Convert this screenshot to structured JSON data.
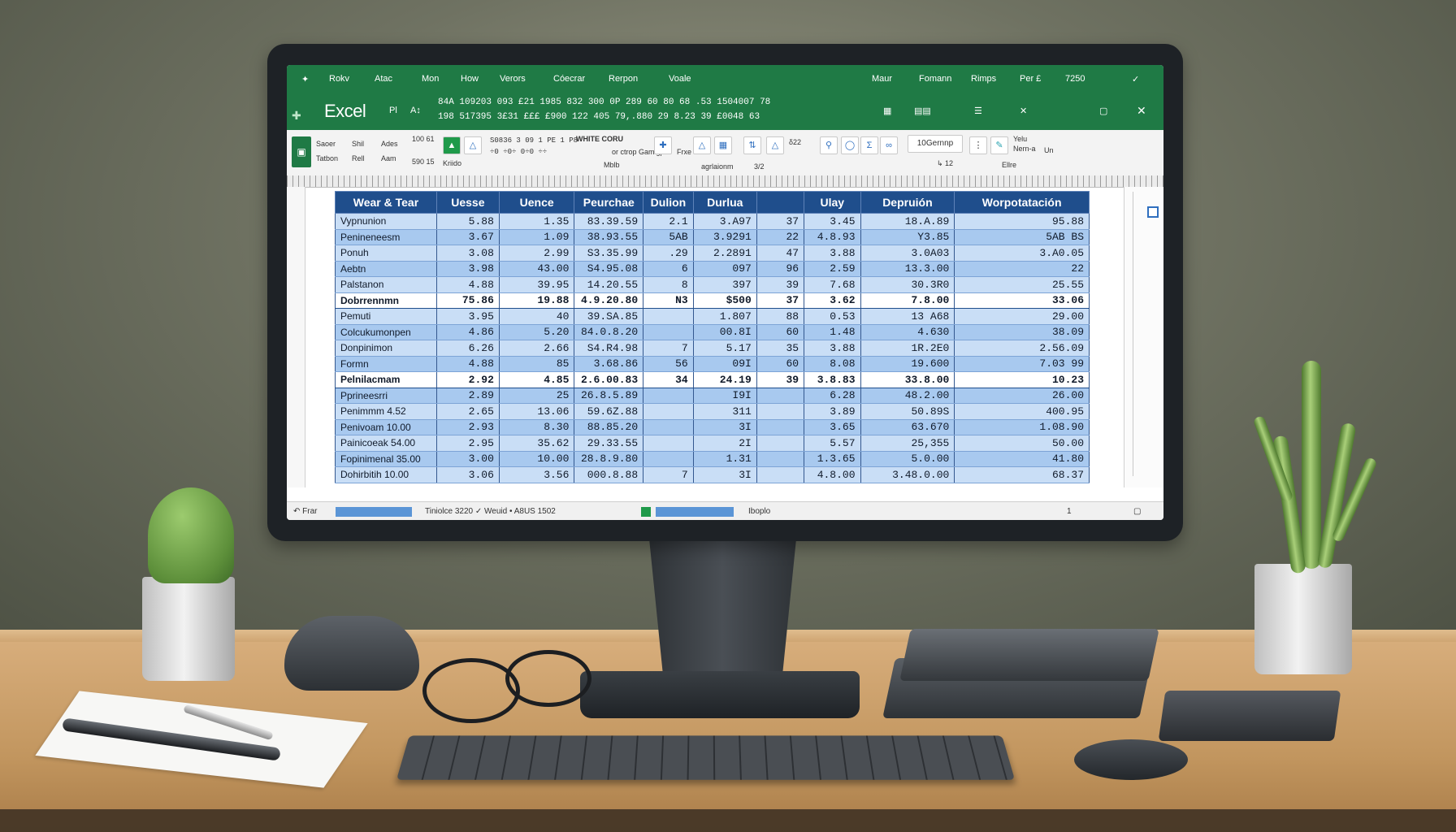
{
  "ribbon": {
    "tabs": [
      "Rokv",
      "Atac",
      "Mon",
      "How",
      "Verors",
      "Cóecrar",
      "Rerpon",
      "Voale"
    ],
    "right_tabs": [
      "Maur",
      "Fomann",
      "Rimps",
      "Per £"
    ],
    "right_value": "7250",
    "app_name": "Excel",
    "num_row_1": "84A  109203  093  £21  1985  832  300  0P  289  60  80  68  .53  1504007  78",
    "num_row_2": "198  517395  3£31  £££  £900  122  405  79,.880  29  8.23  39  £0048  63",
    "font_size": "10Gernnp",
    "tool_labels": [
      "Saoer",
      "Shil",
      "Ades",
      "Tatbon",
      "Rell",
      "Aam",
      "100 61",
      "590 15",
      "Kriido",
      "Mblb",
      "Frxe",
      "agrlaionm",
      "3/2",
      "Ellre",
      "Yelu",
      "Nern-a",
      "Un"
    ]
  },
  "sheet": {
    "headers": [
      "Wear & Tear",
      "Uesse",
      "Uence",
      "Peurchae",
      "Dulion",
      "Durlua",
      "",
      "Ulay",
      "Depruión",
      "Worpotatación"
    ],
    "rows": [
      [
        "Vypnunion",
        "5.88",
        "1.35",
        "83.39.59",
        "2.1",
        "3.A97",
        "37",
        "3.45",
        "18.A.89",
        "95.88"
      ],
      [
        "Penineneesm",
        "3.67",
        "1.09",
        "38.93.55",
        "5AB",
        "3.9291",
        "22",
        "4.8.93",
        "Y3.85",
        "5AB BS"
      ],
      [
        "Ponuh",
        "3.08",
        "2.99",
        "S3.35.99",
        ".29",
        "2.2891",
        "47",
        "3.88",
        "3.0A03",
        "3.A0.05"
      ],
      [
        "Aebtn",
        "3.98",
        "43.00",
        "S4.95.08",
        "6",
        "097",
        "96",
        "2.59",
        "13.3.00",
        "22"
      ],
      [
        "Palstanon",
        "4.88",
        "39.95",
        "14.20.55",
        "8",
        "397",
        "39",
        "7.68",
        "30.3R0",
        "25.55"
      ],
      [
        "Dobrrennmn",
        "75.86",
        "19.88",
        "4.9.20.80",
        "N3",
        "$500",
        "37",
        "3.62",
        "7.8.00",
        "33.06"
      ],
      [
        "Pemuti",
        "3.95",
        "40",
        "39.SA.85",
        "",
        "1.807",
        "88",
        "0.53",
        "13 A68",
        "29.00"
      ],
      [
        "Colcukumonpen",
        "4.86",
        "5.20",
        "84.0.8.20",
        "",
        "00.8I",
        "60",
        "1.48",
        "4.630",
        "38.09"
      ],
      [
        "Donpinimon",
        "6.26",
        "2.66",
        "S4.R4.98",
        "7",
        "5.17",
        "35",
        "3.88",
        "1R.2E0",
        "2.56.09"
      ],
      [
        "Formn",
        "4.88",
        "85",
        "3.68.86",
        "56",
        "09I",
        "60",
        "8.08",
        "19.600",
        "7.03 99"
      ],
      [
        "Pelnilacmam",
        "2.92",
        "4.85",
        "2.6.00.83",
        "34",
        "24.19",
        "39",
        "3.8.83",
        "33.8.00",
        "10.23"
      ],
      [
        "Pprineesrri",
        "2.89",
        "25",
        "26.8.5.89",
        "",
        "I9I",
        "",
        "6.28",
        "48.2.00",
        "26.00"
      ],
      [
        "Penimmm 4.52",
        "2.65",
        "13.06",
        "59.6Z.88",
        "",
        "311",
        "",
        "3.89",
        "50.89S",
        "400.95"
      ],
      [
        "Penivoam 10.00",
        "2.93",
        "8.30",
        "88.85.20",
        "",
        "3I",
        "",
        "3.65",
        "63.670",
        "1.08.90"
      ],
      [
        "Painicoeak 54.00",
        "2.95",
        "35.62",
        "29.33.55",
        "",
        "2I",
        "",
        "5.57",
        "25,355",
        "50.00"
      ],
      [
        "Fopinimenal 35.00",
        "3.00",
        "10.00",
        "28.8.9.80",
        "",
        "1.31",
        "",
        "1.3.65",
        "5.0.00",
        "41.80"
      ],
      [
        "Dohirbitih 10.00",
        "3.06",
        "3.56",
        "000.8.88",
        "7",
        "3I",
        "",
        "4.8.00",
        "3.48.0.00",
        "68.37"
      ]
    ]
  },
  "status": {
    "left": "↶ Frar",
    "middle": "Tiniolce  3220  ✓  Weuid  •  A8US  1502",
    "right": "Iboplo",
    "page": "1"
  },
  "colors": {
    "ribbon_green": "#1f7a45",
    "header_blue": "#1f4e8c",
    "row_light": "#c9def6",
    "row_mid": "#a8c9ef"
  }
}
